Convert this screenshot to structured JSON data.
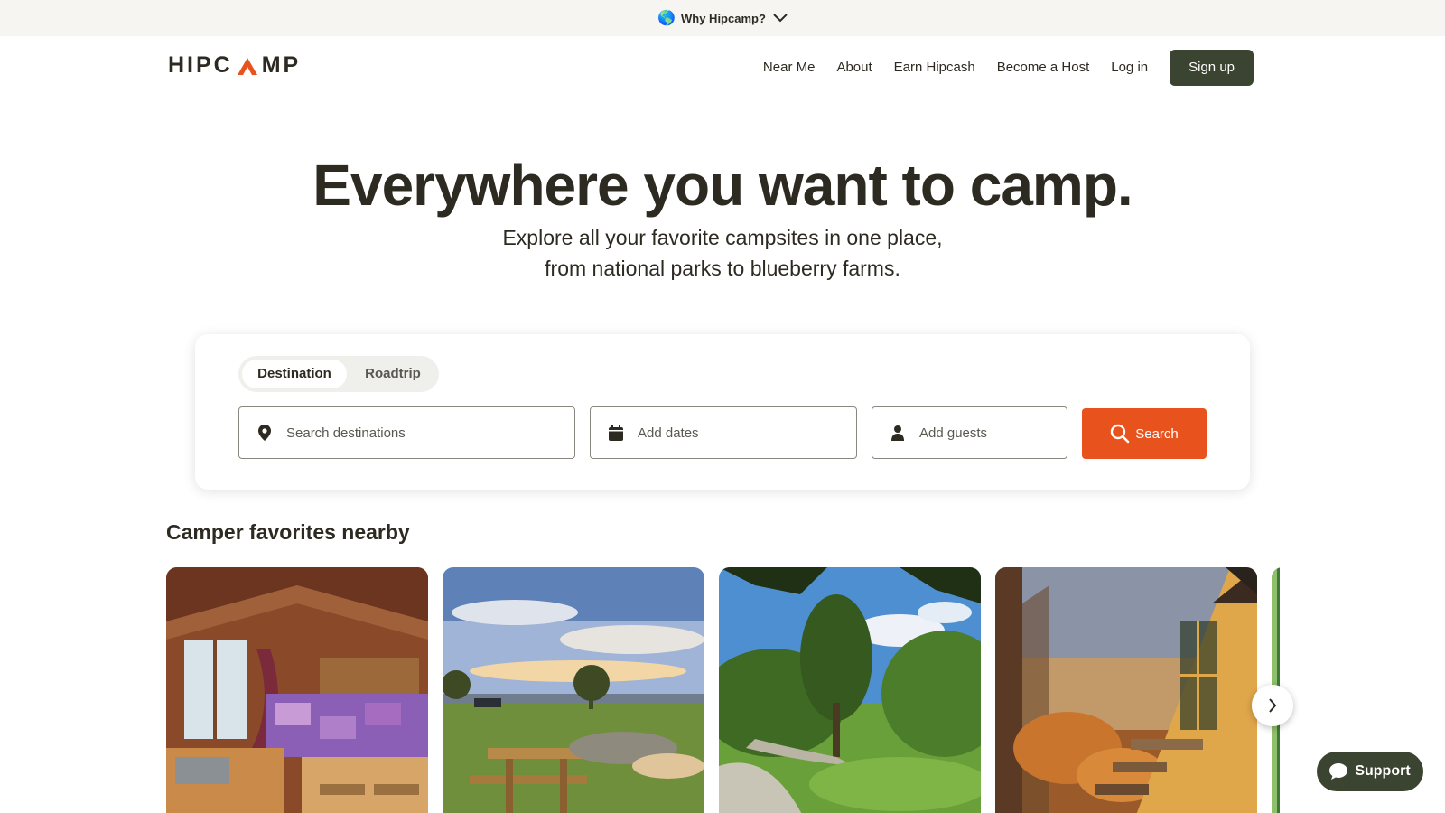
{
  "announcement": {
    "globe": "🌎",
    "label": "Why Hipcamp?"
  },
  "header": {
    "logo": {
      "left": "HIPC",
      "right": "MP"
    },
    "nav": [
      "Near Me",
      "About",
      "Earn Hipcash",
      "Become a Host",
      "Log in"
    ],
    "signup": "Sign up"
  },
  "hero": {
    "title": "Everywhere you want to camp.",
    "subtitle_line1": "Explore all your favorite campsites in one place,",
    "subtitle_line2": "from national parks to blueberry farms."
  },
  "search": {
    "tabs": [
      "Destination",
      "Roadtrip"
    ],
    "active_tab": "Destination",
    "destination_placeholder": "Search destinations",
    "dates_placeholder": "Add dates",
    "guests_placeholder": "Add guests",
    "button": "Search"
  },
  "section": {
    "title": "Camper favorites nearby"
  },
  "cards": [
    {
      "icon": "cabin-interior-photo"
    },
    {
      "icon": "hilltop-picnic-photo"
    },
    {
      "icon": "meadow-trees-photo"
    },
    {
      "icon": "a-frame-cabin-photo"
    },
    {
      "icon": "forest-photo"
    }
  ],
  "support": {
    "label": "Support"
  },
  "colors": {
    "brand_dark": "#3b4430",
    "accent": "#e8521c",
    "text": "#2d2a21"
  }
}
